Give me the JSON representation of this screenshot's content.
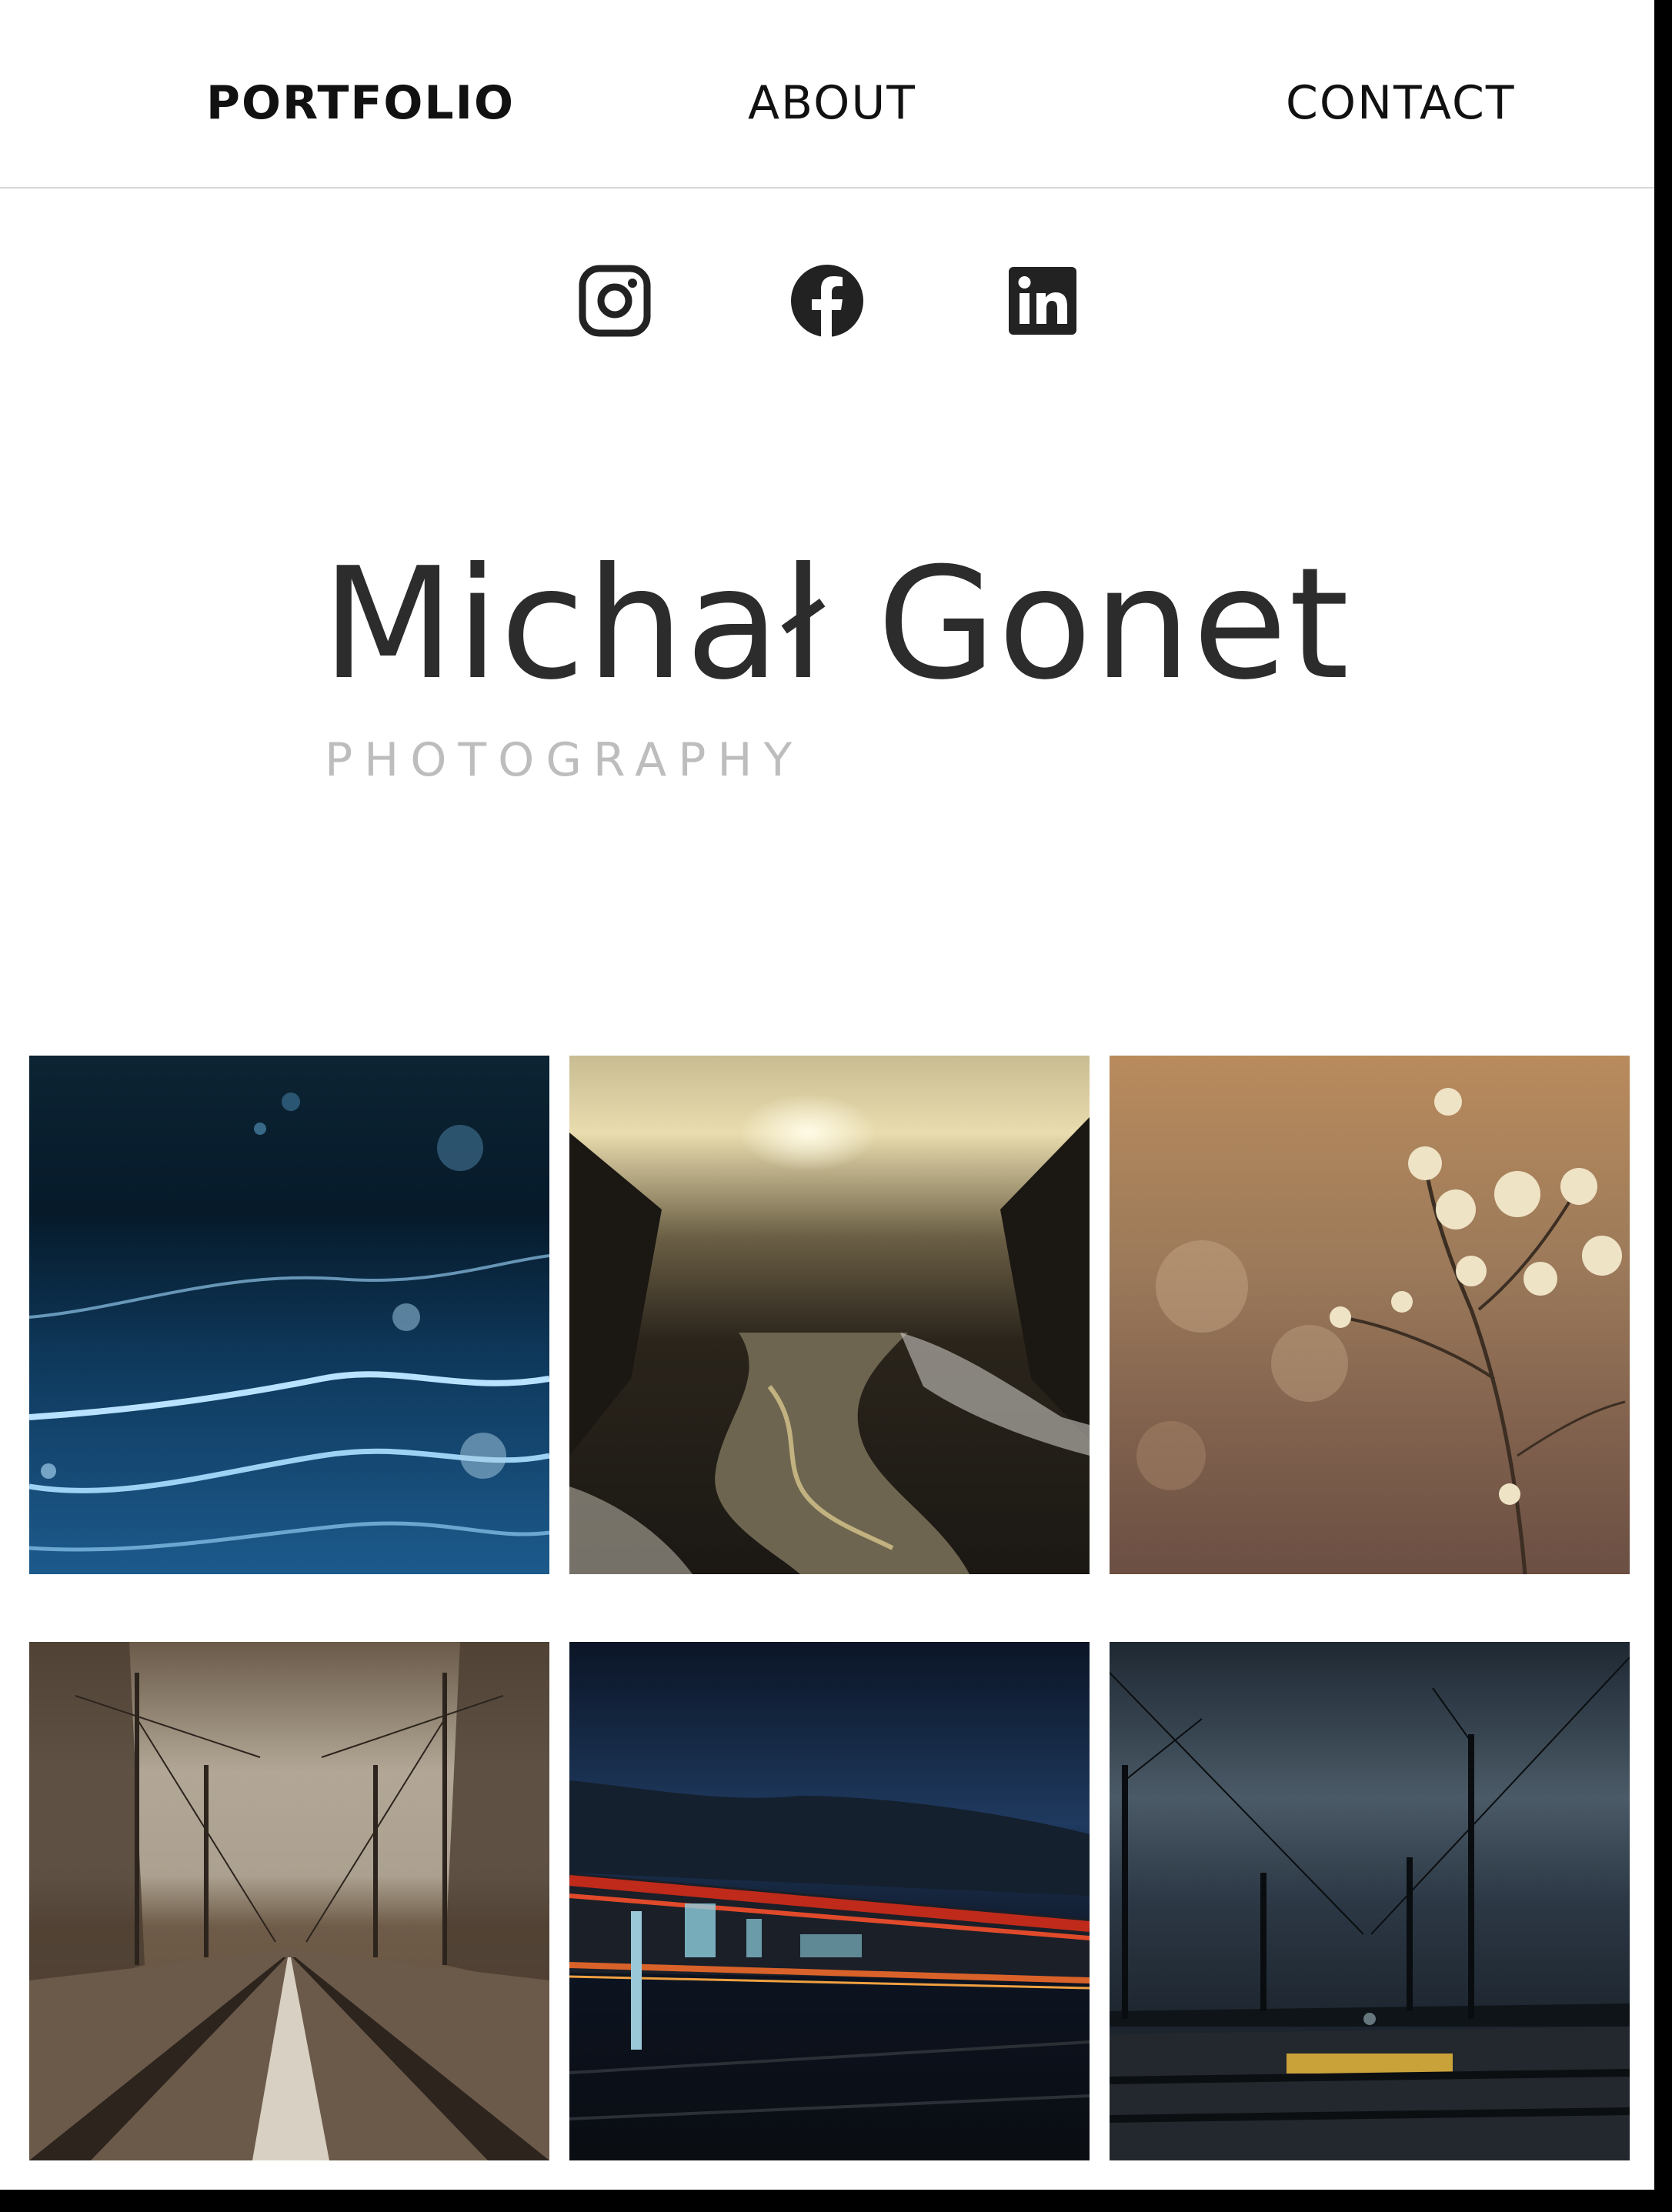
{
  "nav": {
    "portfolio_label": "PORTFOLIO",
    "about_label": "ABOUT",
    "contact_label": "CONTACT",
    "active": "PORTFOLIO"
  },
  "social": [
    {
      "icon": "instagram-icon"
    },
    {
      "icon": "facebook-icon"
    },
    {
      "icon": "linkedin-icon"
    }
  ],
  "hero": {
    "title": "Michał Gonet",
    "subtitle": "PHOTOGRAPHY"
  },
  "gallery": [
    {
      "subject": "blue ice abstract"
    },
    {
      "subject": "winter river at sunset"
    },
    {
      "subject": "dried wildflower"
    },
    {
      "subject": "railway tracks sepia"
    },
    {
      "subject": "train light trails at night"
    },
    {
      "subject": "railway at dusk"
    }
  ],
  "colors": {
    "text": "#111111",
    "title": "#2c2c2c",
    "subtitle": "#bdbdbd",
    "divider": "#d6d6d6",
    "frame": "#000000"
  }
}
